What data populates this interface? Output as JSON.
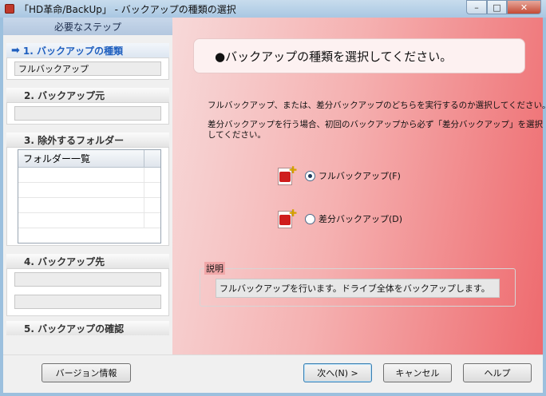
{
  "window": {
    "title": "「HD革命/BackUp」 - バックアップの種類の選択",
    "min": "–",
    "max": "□",
    "close": "✕"
  },
  "steps": {
    "header": "必要なステップ",
    "step1": {
      "label": "1. バックアップの種類",
      "value": "フルバックアップ"
    },
    "step2": {
      "label": "2. バックアップ元"
    },
    "step3": {
      "label": "3. 除外するフォルダー",
      "column": "フォルダー一覧"
    },
    "step4": {
      "label": "4. バックアップ先"
    },
    "step5": {
      "label": "5. バックアップの確認"
    }
  },
  "main": {
    "headline": "●バックアップの種類を選択してください。",
    "para1": "フルバックアップ、または、差分バックアップのどちらを実行するのか選択してください。",
    "para2_line1": "差分バックアップを行う場合、初回のバックアップから必ず「差分バックアップ」を選択",
    "para2_line2": "してください。",
    "options": [
      {
        "label": "フルバックアップ(F)",
        "selected": true
      },
      {
        "label": "差分バックアップ(D)",
        "selected": false
      }
    ],
    "desc_title": "説明",
    "desc_text": "フルバックアップを行います。ドライブ全体をバックアップします。"
  },
  "buttons": {
    "version": "バージョン情報",
    "next": "次へ(N) >",
    "cancel": "キャンセル",
    "help": "ヘルプ"
  }
}
